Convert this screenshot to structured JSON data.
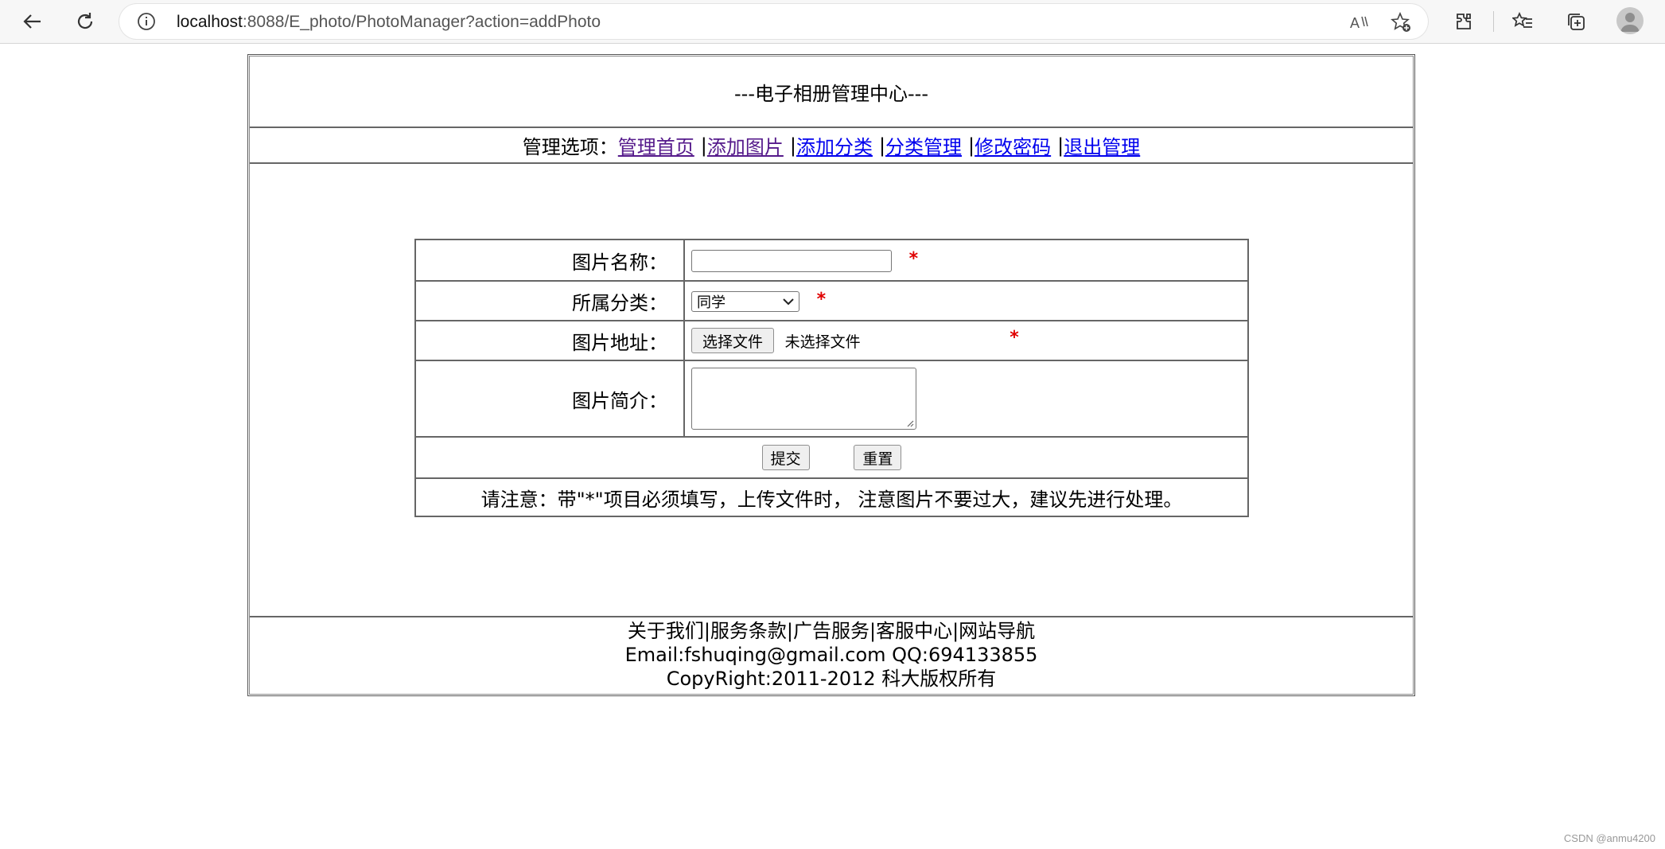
{
  "browser": {
    "url_host": "localhost",
    "url_rest": ":8088/E_photo/PhotoManager?action=addPhoto"
  },
  "header": {
    "title": "---电子相册管理中心---"
  },
  "menu": {
    "prefix": "管理选项：",
    "sep": "|",
    "items": [
      {
        "label": "管理首页"
      },
      {
        "label": "添加图片"
      },
      {
        "label": "添加分类"
      },
      {
        "label": "分类管理"
      },
      {
        "label": "修改密码"
      },
      {
        "label": "退出管理"
      }
    ]
  },
  "form": {
    "required_mark": "*",
    "name_label": "图片名称：",
    "name_value": "",
    "category_label": "所属分类：",
    "category_selected": "同学",
    "file_label": "图片地址：",
    "file_button": "选择文件",
    "file_status": "未选择文件",
    "intro_label": "图片简介：",
    "submit_label": "提交",
    "reset_label": "重置",
    "notice": "请注意：带\"*\"项目必须填写，上传文件时， 注意图片不要过大，建议先进行处理。"
  },
  "footer": {
    "links_line": "关于我们|服务条款|广告服务|客服中心|网站导航",
    "contact_line": "Email:fshuqing@gmail.com QQ:694133855",
    "copyright_line": "CopyRight:2011-2012 科大版权所有"
  },
  "watermark": "CSDN @anmu4200"
}
